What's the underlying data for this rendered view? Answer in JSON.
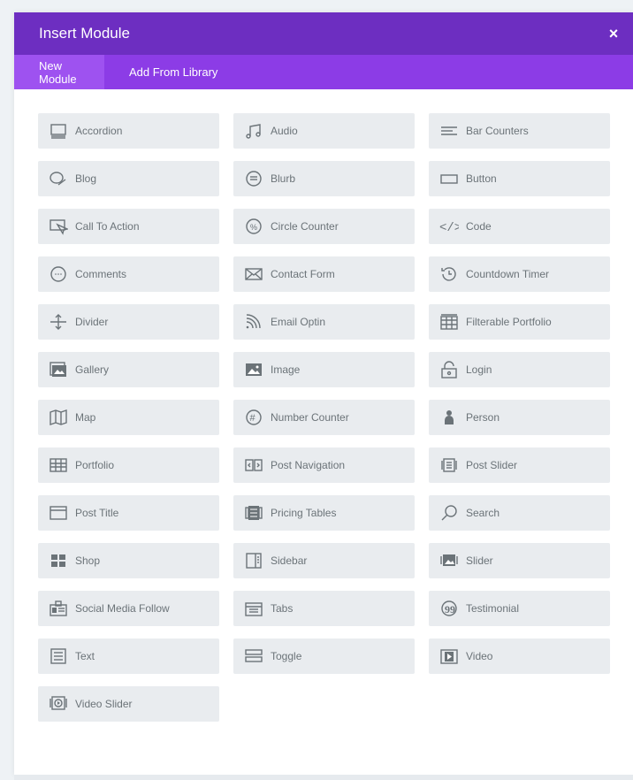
{
  "dialog": {
    "title": "Insert Module",
    "close_label": "×",
    "tabs": [
      {
        "label": "New Module"
      },
      {
        "label": "Add From Library"
      }
    ]
  },
  "colors": {
    "titlebar": "#6d2ec1",
    "tabbar": "#8c3ce6",
    "active_tab": "#9e52f0",
    "module_bg": "#e9ecef",
    "module_text": "#6b7378"
  },
  "modules": [
    {
      "label": "Accordion",
      "icon": "accordion-icon"
    },
    {
      "label": "Audio",
      "icon": "audio-icon"
    },
    {
      "label": "Bar Counters",
      "icon": "bar-counters-icon"
    },
    {
      "label": "Blog",
      "icon": "blog-icon"
    },
    {
      "label": "Blurb",
      "icon": "blurb-icon"
    },
    {
      "label": "Button",
      "icon": "button-icon"
    },
    {
      "label": "Call To Action",
      "icon": "call-to-action-icon"
    },
    {
      "label": "Circle Counter",
      "icon": "circle-counter-icon"
    },
    {
      "label": "Code",
      "icon": "code-icon"
    },
    {
      "label": "Comments",
      "icon": "comments-icon"
    },
    {
      "label": "Contact Form",
      "icon": "contact-form-icon"
    },
    {
      "label": "Countdown Timer",
      "icon": "countdown-timer-icon"
    },
    {
      "label": "Divider",
      "icon": "divider-icon"
    },
    {
      "label": "Email Optin",
      "icon": "email-optin-icon"
    },
    {
      "label": "Filterable Portfolio",
      "icon": "filterable-portfolio-icon"
    },
    {
      "label": "Gallery",
      "icon": "gallery-icon"
    },
    {
      "label": "Image",
      "icon": "image-icon"
    },
    {
      "label": "Login",
      "icon": "login-icon"
    },
    {
      "label": "Map",
      "icon": "map-icon"
    },
    {
      "label": "Number Counter",
      "icon": "number-counter-icon"
    },
    {
      "label": "Person",
      "icon": "person-icon"
    },
    {
      "label": "Portfolio",
      "icon": "portfolio-icon"
    },
    {
      "label": "Post Navigation",
      "icon": "post-navigation-icon"
    },
    {
      "label": "Post Slider",
      "icon": "post-slider-icon"
    },
    {
      "label": "Post Title",
      "icon": "post-title-icon"
    },
    {
      "label": "Pricing Tables",
      "icon": "pricing-tables-icon"
    },
    {
      "label": "Search",
      "icon": "search-icon"
    },
    {
      "label": "Shop",
      "icon": "shop-icon"
    },
    {
      "label": "Sidebar",
      "icon": "sidebar-icon"
    },
    {
      "label": "Slider",
      "icon": "slider-icon"
    },
    {
      "label": "Social Media Follow",
      "icon": "social-media-follow-icon"
    },
    {
      "label": "Tabs",
      "icon": "tabs-icon"
    },
    {
      "label": "Testimonial",
      "icon": "testimonial-icon"
    },
    {
      "label": "Text",
      "icon": "text-icon"
    },
    {
      "label": "Toggle",
      "icon": "toggle-icon"
    },
    {
      "label": "Video",
      "icon": "video-icon"
    },
    {
      "label": "Video Slider",
      "icon": "video-slider-icon"
    }
  ]
}
